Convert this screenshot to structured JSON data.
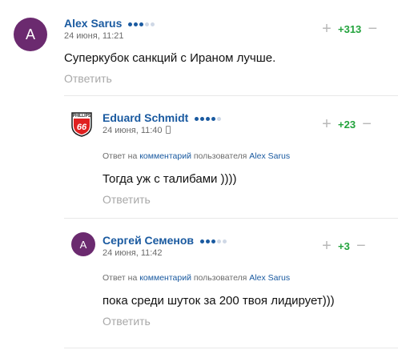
{
  "comments": [
    {
      "avatar_letter": "A",
      "avatar_color": "#6b2a6f",
      "username": "Alex Sarus",
      "date": "24 июня, 11:21",
      "score": "+313",
      "text": "Суперкубок санкций с Ираном лучше.",
      "reply_label": "Ответить",
      "rating_dots": 3
    },
    {
      "avatar_logo": "phillips-66-logo",
      "avatar_logo_top_text": "PHILLIPS",
      "avatar_logo_number": "66",
      "username": "Eduard Schmidt",
      "date": "24 июня, 11:40",
      "score": "+23",
      "reply_to_prefix": "Ответ на",
      "reply_to_link": "комментарий",
      "reply_to_mid": "пользователя",
      "reply_to_user": "Alex Sarus",
      "text": "Тогда уж с талибами ))))",
      "reply_label": "Ответить",
      "rating_dots": 4
    },
    {
      "avatar_letter": "A",
      "avatar_color": "#6b2a6f",
      "username": "Сергей Семенов",
      "date": "24 июня, 11:42",
      "score": "+3",
      "reply_to_prefix": "Ответ на",
      "reply_to_link": "комментарий",
      "reply_to_mid": "пользователя",
      "reply_to_user": "Alex Sarus",
      "text": "пока среди шуток за 200 твоя лидирует)))",
      "reply_label": "Ответить",
      "rating_dots": 3
    }
  ],
  "colors": {
    "dot_active": "#1a5aa0",
    "dot_inactive": "#cfd8e6",
    "score_positive": "#23a33d",
    "username": "#1a5aa0"
  }
}
